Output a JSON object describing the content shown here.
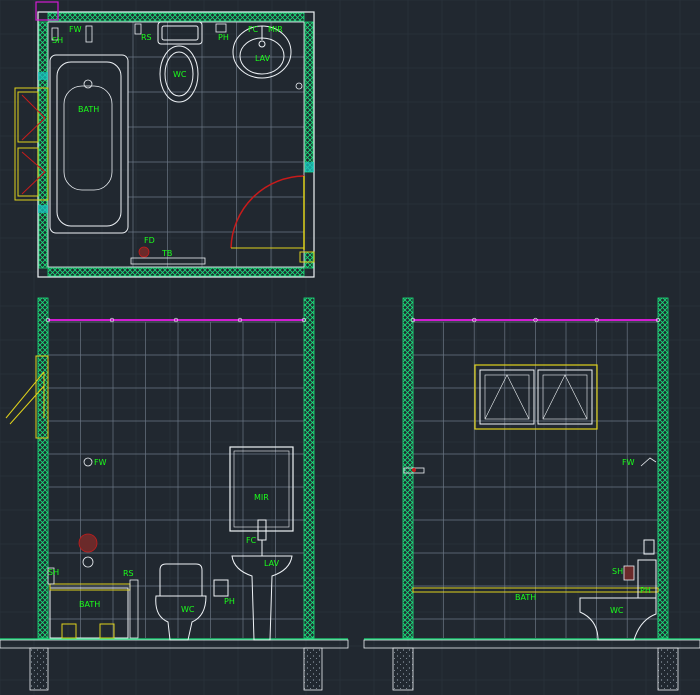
{
  "colors": {
    "background": "#212830",
    "grid": "#2d3640",
    "tile": "#6b7684",
    "wall": "#19e07a",
    "label": "#1bff1b",
    "magenta": "#d21bd2",
    "yellow": "#e0d21b",
    "red": "#c81b1b",
    "white": "#eef2f6",
    "cyan": "#19c8c8"
  },
  "plan": {
    "labels": {
      "fw": "FW",
      "sh": "SH",
      "rs": "RS",
      "ph": "PH",
      "fc": "FC",
      "mir": "MIR",
      "wc": "WC",
      "lav": "LAV",
      "bath": "BATH",
      "fd": "FD",
      "tb": "TB"
    }
  },
  "elevation_left": {
    "labels": {
      "fw": "FW",
      "sh": "SH",
      "rs": "RS",
      "bath": "BATH",
      "wc": "WC",
      "ph": "PH",
      "fc": "FC",
      "lav": "LAV",
      "mir": "MIR"
    }
  },
  "elevation_right": {
    "labels": {
      "fw": "FW",
      "sh": "SH",
      "bath": "BATH",
      "wc": "WC",
      "ph": "PH"
    }
  }
}
